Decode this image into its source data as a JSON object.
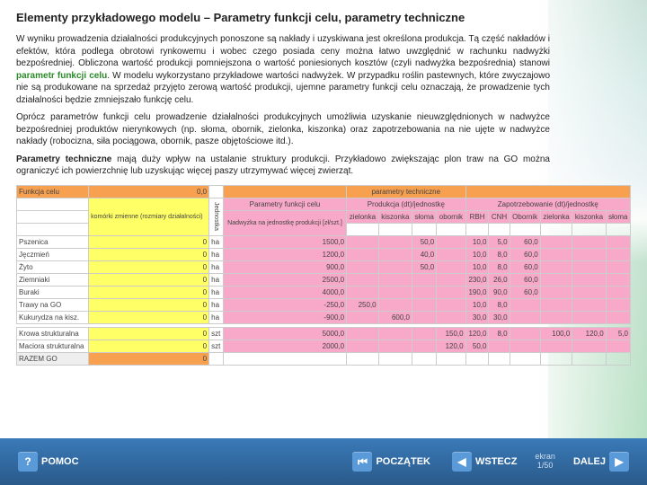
{
  "title": "Elementy przykładowego modelu – Parametry funkcji celu, parametry techniczne",
  "para1": "W wyniku prowadzenia działalności produkcyjnych ponoszone są nakłady i uzyskiwana jest określona produkcja. Tą część nakładów i efektów, która podlega obrotowi rynkowemu i wobec czego posiada ceny można łatwo uwzględnić w rachunku nadwyżki bezpośredniej. Obliczona wartość produkcji pomniejszona o wartość poniesionych kosztów (czyli nadwyżka bezpośrednia) stanowi ",
  "hl1": "parametr funkcji celu",
  "para1b": ". W modelu wykorzystano przykładowe wartości nadwyżek. W przypadku roślin pastewnych, które zwyczajowo nie są produkowane na sprzedaż przyjęto zerową wartość produkcji, ujemne parametry funkcji celu oznaczają, że prowadzenie tych działalności będzie zmniejszało funkcję celu.",
  "para2": "Oprócz parametrów funkcji celu prowadzenie działalności produkcyjnych umożliwia uzyskanie nieuwzględnionych w nadwyżce bezpośredniej produktów nierynkowych (np. słoma, obornik, zielonka, kiszonka) oraz zapotrzebowania na nie ujęte w nadwyżce nakłady (robocizna, siła pociągowa, obornik, pasze objętościowe itd.).",
  "para3a": "Parametry techniczne",
  "para3b": " mają duży wpływ na ustalanie struktury produkcji. Przykładowo zwiększając plon traw na GO można ograniczyć ich powierzchnię lub uzyskując więcej paszy utrzymywać więcej zwierząt.",
  "tbl": {
    "h_fc": "Funkcja celu",
    "h_fc_val": "0,0",
    "h_pt": "parametry techniczne",
    "h_pfc": "Parametry funkcji celu",
    "h_prod": "Produkcja (dt)/jednostkę",
    "h_zap": "Zapotrzebowanie (dt)/jednostkę",
    "h_nad": "Nadwyżka na jednostkę produkcji [zł/szt.]",
    "sub_prod": [
      "zielonka",
      "kiszonka",
      "słoma",
      "obornik"
    ],
    "sub_zap": [
      "RBH",
      "CNH",
      "Obornik",
      "zielonka",
      "kiszonka",
      "słoma"
    ],
    "yellow_note": "komórki zmienne (rozmiary działalności)",
    "rot": "Jednostka",
    "rows": [
      {
        "n": "Pszenica",
        "u": "ha",
        "v": "0",
        "p": [
          "1500,0"
        ],
        "pr": [
          "",
          "",
          "50,0",
          ""
        ],
        "z": [
          "10,0",
          "5,0",
          "60,0",
          "",
          "",
          ""
        ]
      },
      {
        "n": "Jęczmień",
        "u": "ha",
        "v": "0",
        "p": [
          "1200,0"
        ],
        "pr": [
          "",
          "",
          "40,0",
          ""
        ],
        "z": [
          "10,0",
          "8,0",
          "60,0",
          "",
          "",
          ""
        ]
      },
      {
        "n": "Żyto",
        "u": "ha",
        "v": "0",
        "p": [
          "900,0"
        ],
        "pr": [
          "",
          "",
          "50,0",
          ""
        ],
        "z": [
          "10,0",
          "8,0",
          "60,0",
          "",
          "",
          ""
        ]
      },
      {
        "n": "Ziemniaki",
        "u": "ha",
        "v": "0",
        "p": [
          "2500,0"
        ],
        "pr": [
          "",
          "",
          "",
          ""
        ],
        "z": [
          "230,0",
          "26,0",
          "60,0",
          "",
          "",
          ""
        ]
      },
      {
        "n": "Buraki",
        "u": "ha",
        "v": "0",
        "p": [
          "4000,0"
        ],
        "pr": [
          "",
          "",
          "",
          ""
        ],
        "z": [
          "190,0",
          "90,0",
          "60,0",
          "",
          "",
          ""
        ]
      },
      {
        "n": "Trawy na GO",
        "u": "ha",
        "v": "0",
        "p": [
          "-250,0"
        ],
        "pr": [
          "250,0",
          "",
          "",
          ""
        ],
        "z": [
          "10,0",
          "8,0",
          "",
          "",
          "",
          ""
        ]
      },
      {
        "n": "Kukurydza na kisz.",
        "u": "ha",
        "v": "0",
        "p": [
          "-900,0"
        ],
        "pr": [
          "",
          "600,0",
          "",
          ""
        ],
        "z": [
          "30,0",
          "30,0",
          "",
          "",
          "",
          ""
        ]
      }
    ],
    "srows": [
      {
        "n": "Krowa strukturalna",
        "u": "szt",
        "v": "0",
        "p": [
          "5000,0"
        ],
        "pr": [
          "",
          "",
          "",
          "150,0"
        ],
        "z": [
          "120,0",
          "8,0",
          "",
          "100,0",
          "120,0",
          "5,0"
        ]
      },
      {
        "n": "Maciora strukturalna",
        "u": "szt",
        "v": "0",
        "p": [
          "2000,0"
        ],
        "pr": [
          "",
          "",
          "",
          "120,0"
        ],
        "z": [
          "50,0",
          "",
          "",
          "",
          "",
          ""
        ]
      }
    ],
    "razem": "RAZEM GO",
    "razem_v": "0"
  },
  "footer": {
    "pomoc": "POMOC",
    "poczatek": "POCZĄTEK",
    "wstecz": "WSTECZ",
    "dalej": "DALEJ",
    "ekran_lbl": "ekran",
    "ekran_v": "1/50"
  }
}
